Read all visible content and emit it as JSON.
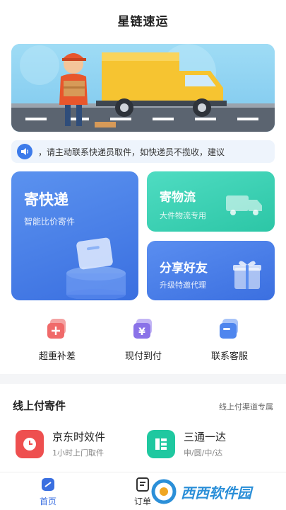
{
  "header": {
    "title": "星链速运"
  },
  "notice": {
    "text": "，请主动联系快递员取件，如快递员不揽收，建议"
  },
  "cards": [
    {
      "title": "寄快递",
      "subtitle": "智能比价寄件"
    },
    {
      "title": "寄物流",
      "subtitle": "大件物流专用"
    },
    {
      "title": "分享好友",
      "subtitle": "升级特邀代理"
    }
  ],
  "quick": [
    {
      "label": "超重补差",
      "icon": "plus-card-icon",
      "color": "#f06a6a"
    },
    {
      "label": "现付到付",
      "icon": "yen-card-icon",
      "color": "#8a72e8"
    },
    {
      "label": "联系客服",
      "icon": "service-card-icon",
      "color": "#4f86ee"
    }
  ],
  "section": {
    "title": "线上付寄件",
    "more": "线上付渠道专属",
    "services": [
      {
        "name": "京东时效件",
        "desc": "1小时上门取件",
        "icon": "clock-icon",
        "color": "#ee4f4f"
      },
      {
        "name": "三通一达",
        "desc": "申/圆/中/达",
        "icon": "grid-icon",
        "color": "#1fc8a0"
      }
    ]
  },
  "tabs": [
    {
      "label": "首页",
      "active": true
    },
    {
      "label": "订单",
      "active": false
    }
  ],
  "watermark": {
    "text": "西西软件园"
  },
  "colors": {
    "primary": "#3a6fe0",
    "teal": "#2cc6a6",
    "activeTab": "#3a6fe0"
  }
}
